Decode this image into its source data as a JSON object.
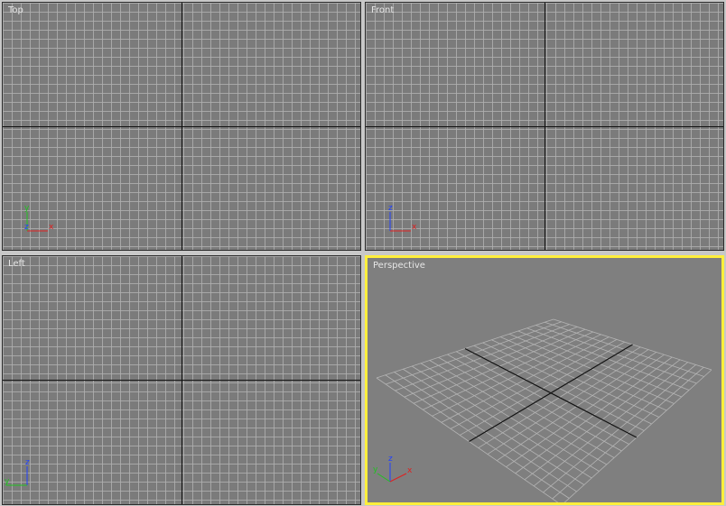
{
  "viewports": {
    "top": {
      "label": "Top",
      "axes": {
        "up": "y",
        "right": "x",
        "center": "z"
      }
    },
    "front": {
      "label": "Front",
      "axes": {
        "up": "z",
        "right": "x"
      }
    },
    "left": {
      "label": "Left",
      "axes": {
        "up": "z",
        "right": "y"
      }
    },
    "perspective": {
      "label": "Perspective",
      "active": true,
      "axes": {
        "up": "z",
        "right": "x",
        "depth": "y"
      }
    }
  },
  "colors": {
    "axis_x": "#e02020",
    "axis_y": "#20c020",
    "axis_z": "#2040ff",
    "active_border": "#ffef3b",
    "grid_line": "#afafaf",
    "main_axis": "#111111",
    "background": "#7b7b7b"
  }
}
